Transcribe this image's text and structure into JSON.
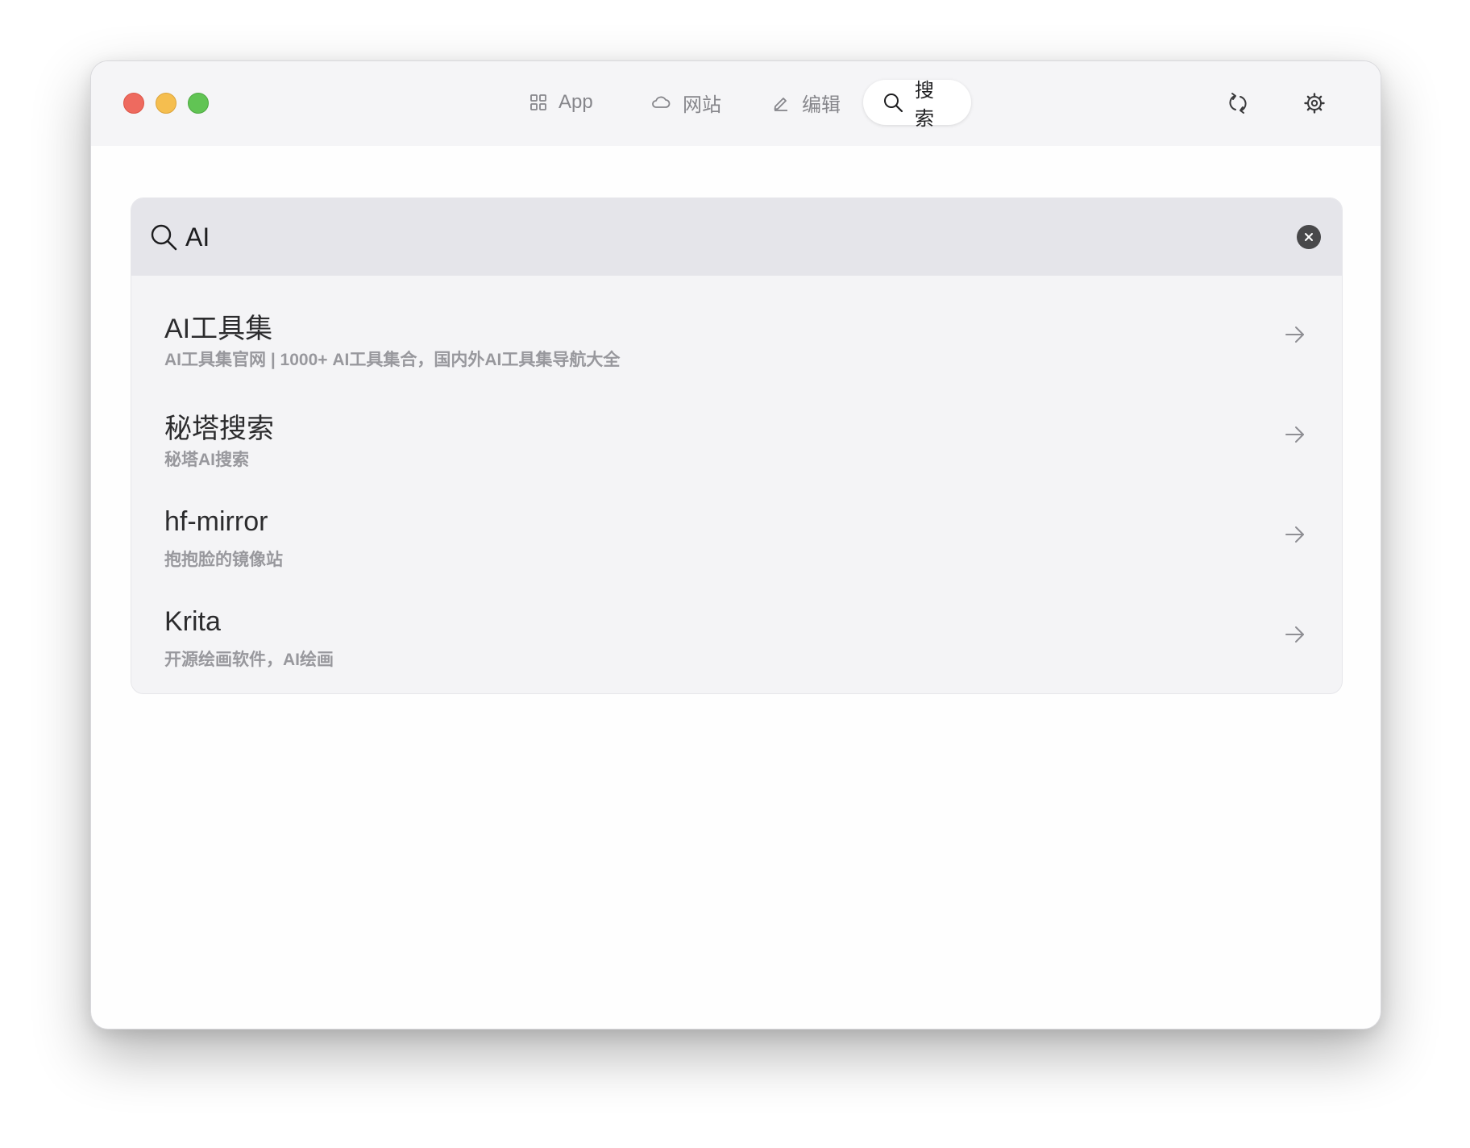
{
  "window": {
    "traffic_lights": [
      "close",
      "minimize",
      "zoom"
    ]
  },
  "tabs": [
    {
      "label": "App",
      "icon": "grid-icon",
      "active": false
    },
    {
      "label": "网站",
      "icon": "cloud-icon",
      "active": false
    },
    {
      "label": "编辑",
      "icon": "pencil-icon",
      "active": false
    },
    {
      "label": "搜索",
      "icon": "search-icon",
      "active": true
    }
  ],
  "toolbar": {
    "refresh_icon": "refresh-icon",
    "settings_icon": "gear-icon"
  },
  "search": {
    "value": "AI",
    "clear_icon": "clear-icon"
  },
  "results": [
    {
      "title": "AI工具集",
      "description": "AI工具集官网 | 1000+ AI工具集合，国内外AI工具集导航大全"
    },
    {
      "title": "秘塔搜索",
      "description": "秘塔AI搜索"
    },
    {
      "title": "hf-mirror",
      "description": "抱抱脸的镜像站"
    },
    {
      "title": "Krita",
      "description": "开源绘画软件，AI绘画"
    }
  ],
  "colors": {
    "accent_active_tab": "#ffffff",
    "titlebar": "#f5f5f7",
    "panel": "#f4f4f6",
    "search_bar": "#e5e5ea"
  }
}
